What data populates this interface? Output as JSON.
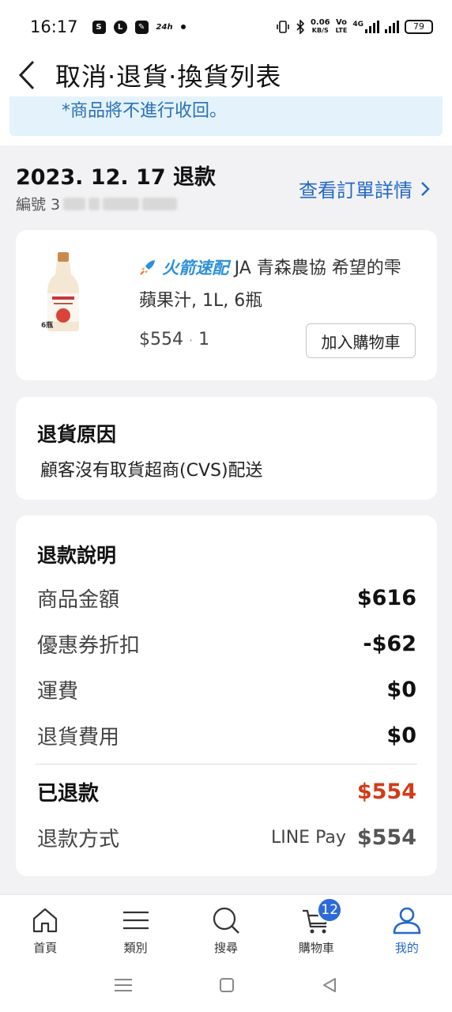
{
  "status_bar": {
    "time": "16:17",
    "notif_24h": "24h",
    "net_speed_value": "0.06",
    "net_speed_unit": "KB/S",
    "volte": "Vo",
    "lte": "LTE",
    "network_type": "4G",
    "battery": "79"
  },
  "header": {
    "title": "取消·退貨·換貨列表"
  },
  "notice": {
    "text": "*商品將不進行收回。"
  },
  "order": {
    "date_status": "2023. 12. 17 退款",
    "number_label": "編號 3",
    "detail_link": "查看訂單詳情"
  },
  "product": {
    "badge": "6瓶",
    "delivery_tag": "火箭速配",
    "title": "JA 青森農協 希望的雫 蘋果汁, 1L, 6瓶",
    "price": "$554",
    "quantity": "1",
    "add_to_cart": "加入購物車"
  },
  "reason": {
    "title": "退貨原因",
    "text": "顧客沒有取貨超商(CVS)配送"
  },
  "refund": {
    "title": "退款說明",
    "rows": [
      {
        "label": "商品金額",
        "amount": "$616"
      },
      {
        "label": "優惠券折扣",
        "amount": "-$62"
      },
      {
        "label": "運費",
        "amount": "$0"
      },
      {
        "label": "退貨費用",
        "amount": "$0"
      }
    ],
    "refunded_label": "已退款",
    "refunded_amount": "$554",
    "method_label": "退款方式",
    "method_name": "LINE Pay",
    "method_amount": "$554",
    "accent_color": "#d23b16"
  },
  "bottom_nav": {
    "items": [
      {
        "label": "首頁",
        "icon": "home-icon"
      },
      {
        "label": "類別",
        "icon": "menu-icon"
      },
      {
        "label": "搜尋",
        "icon": "search-icon"
      },
      {
        "label": "購物車",
        "icon": "cart-icon"
      },
      {
        "label": "我的",
        "icon": "user-icon"
      }
    ],
    "cart_count": "12",
    "active_color": "#2468c9"
  }
}
